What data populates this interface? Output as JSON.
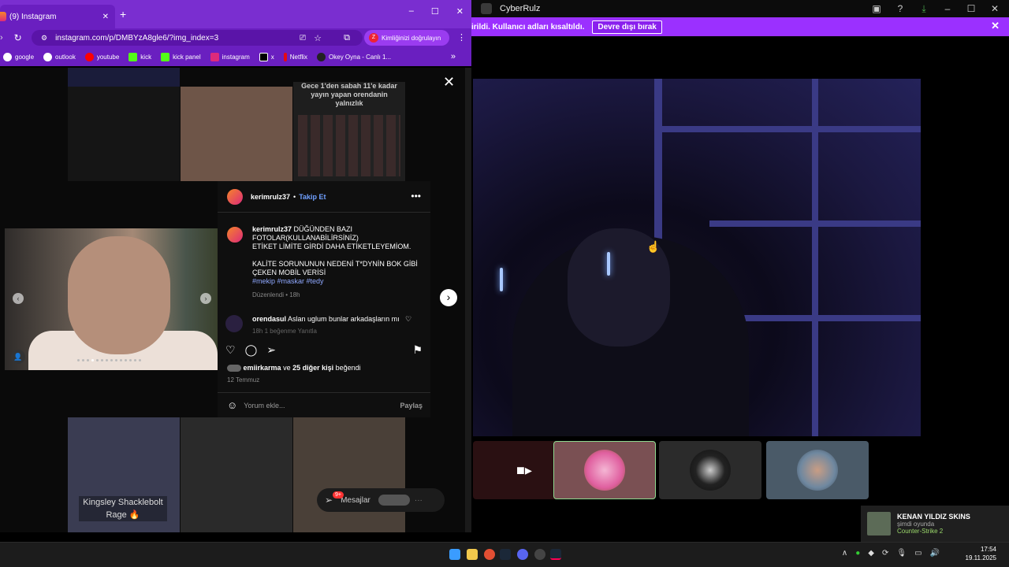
{
  "app": {
    "title": "CyberRulz",
    "banner_text": "irildi. Kullanıcı adları kısaltıldı.",
    "banner_button": "Devre dışı bırak",
    "game_notification": {
      "name": "KENAN YILDIZ SKINS",
      "status": "şimdi oyunda",
      "game": "Counter-Strike 2"
    }
  },
  "browser": {
    "tab_title": "(9) Instagram",
    "url": "instagram.com/p/DMBYzA8gle6/?img_index=3",
    "verify_label": "Kimliğinizi doğrulayın",
    "bookmarks": [
      {
        "label": "google",
        "color": "#ffffff"
      },
      {
        "label": "outlook",
        "color": "#ffffff"
      },
      {
        "label": "youtube",
        "color": "#ff0000"
      },
      {
        "label": "kick",
        "color": "#53fc18"
      },
      {
        "label": "kick panel",
        "color": "#53fc18"
      },
      {
        "label": "instagram",
        "color": "#dd2a7b"
      },
      {
        "label": "x",
        "color": "#000000"
      },
      {
        "label": "Netflix",
        "color": "#e50914"
      },
      {
        "label": "Okey Oyna - Canlı 1...",
        "color": "#222222"
      }
    ]
  },
  "grid_caption": "Gece 1'den sabah 11'e kadar yayın yapan orendanin yalnızlık",
  "grid_label": "Kingsley Shacklebolt Rage 🔥",
  "post": {
    "username": "kerimrulz37",
    "follow_label": "Takip Et",
    "caption_line1": "DÜĞÜNDEN BAZI FOTOLAR(KULLANABİLİRSİNİZ)",
    "caption_line2": "ETİKET LİMİTE GİRDİ DAHA ETİKETLEYEMİOM.",
    "caption_line3": "KALİTE SORUNUNUN NEDENİ T*DYNİN BOK GİBİ ÇEKEN MOBİL VERİSİ",
    "tags": "#mekip #maskar #tedy",
    "edited": "Düzenlendi • 18h",
    "comment_user": "orendasul",
    "comment_text": "Aslan uglum bunlar arkadaşların mı",
    "comment_meta": "18h   1 beğenme   Yanıtla",
    "likes_user": "emiirkarma",
    "likes_rest": " ve ",
    "likes_count": "25 diğer kişi",
    "likes_suffix": " beğendi",
    "date": "12 Temmuz",
    "comment_placeholder": "Yorum ekle...",
    "post_label": "Paylaş"
  },
  "messages": {
    "label": "Mesajlar",
    "badge": "9+"
  },
  "clock": {
    "time": "17:54",
    "date": "19.11.2025"
  }
}
